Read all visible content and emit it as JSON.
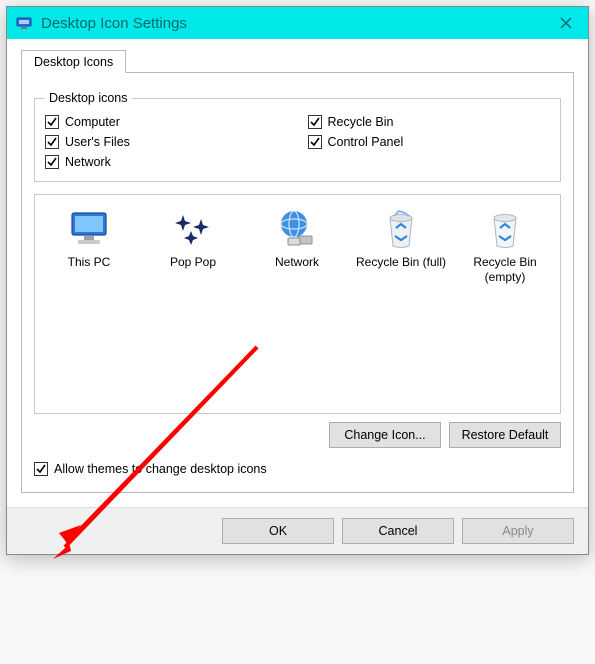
{
  "title": "Desktop Icon Settings",
  "tab": {
    "label": "Desktop Icons"
  },
  "group": {
    "legend": "Desktop icons"
  },
  "checks": {
    "computer": {
      "label": "Computer"
    },
    "userfiles": {
      "label": "User's Files"
    },
    "network": {
      "label": "Network"
    },
    "recyclebin": {
      "label": "Recycle Bin"
    },
    "controlpanel": {
      "label": "Control Panel"
    }
  },
  "icons": {
    "thispc": {
      "label": "This PC"
    },
    "poppop": {
      "label": "Pop Pop"
    },
    "network": {
      "label": "Network"
    },
    "binfull": {
      "label": "Recycle Bin (full)"
    },
    "binempty": {
      "label": "Recycle Bin (empty)"
    }
  },
  "buttons": {
    "change": "Change Icon...",
    "restore": "Restore Default",
    "ok": "OK",
    "cancel": "Cancel",
    "apply": "Apply"
  },
  "allow": {
    "label": "Allow themes to change desktop icons"
  },
  "colors": {
    "titlebar": "#00e8e8",
    "titletext": "#006a6a",
    "arrow": "#ff0000"
  }
}
